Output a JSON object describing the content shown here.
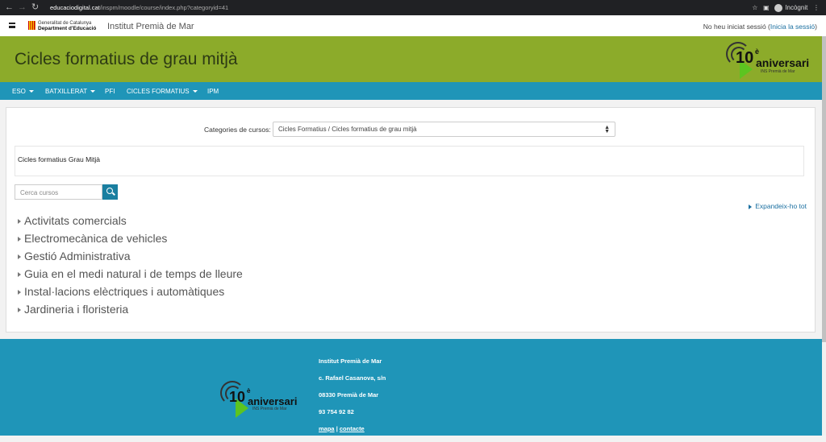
{
  "browser": {
    "url_host": "educaciodigital.cat",
    "url_path": "/inspm/moodle/course/index.php?categoryid=41",
    "profile_label": "Incògnit"
  },
  "topnav": {
    "gencat_line1": "Generalitat de Catalunya",
    "gencat_line2": "Department d'Educació",
    "site_name": "Institut Premià de Mar",
    "login_text": "No heu iniciat sessió (",
    "login_link": "Inicia la sessió",
    "login_close": ")"
  },
  "banner": {
    "title": "Cicles formatius de grau mitjà",
    "logo_num": "10",
    "logo_sup": "è",
    "logo_text": "aniversari",
    "logo_sub": "INS Premià de Mar"
  },
  "menu": {
    "items": [
      {
        "label": "ESO",
        "dropdown": true
      },
      {
        "label": "BATXILLERAT",
        "dropdown": true
      },
      {
        "label": "PFI",
        "dropdown": false
      },
      {
        "label": "CICLES FORMATIUS",
        "dropdown": true
      },
      {
        "label": "IPM",
        "dropdown": false
      }
    ]
  },
  "main": {
    "category_label": "Categories de cursos:",
    "category_value": "Cicles Formatius / Cicles formatius de grau mitjà",
    "description": "Cicles formatius Grau Mitjà",
    "search_placeholder": "Cerca cursos",
    "expand_all": "Expandeix-ho tot",
    "courses": [
      "Activitats comercials",
      "Electromecànica de vehicles",
      "Gestió Administrativa",
      "Guia en el medi natural i de temps de lleure",
      "Instal·lacions elèctriques i automàtiques",
      "Jardineria i floristeria"
    ]
  },
  "footer": {
    "name": "Institut Premià de Mar",
    "address": "c. Rafael Casanova, s/n",
    "city": "08330 Premià de Mar",
    "phone": "93 754 92 82",
    "link_map": "mapa",
    "separator": "|",
    "link_contact": "contacte"
  },
  "colors": {
    "banner": "#8cab2a",
    "menu": "#1f95b8",
    "link": "#1a6fa0"
  }
}
